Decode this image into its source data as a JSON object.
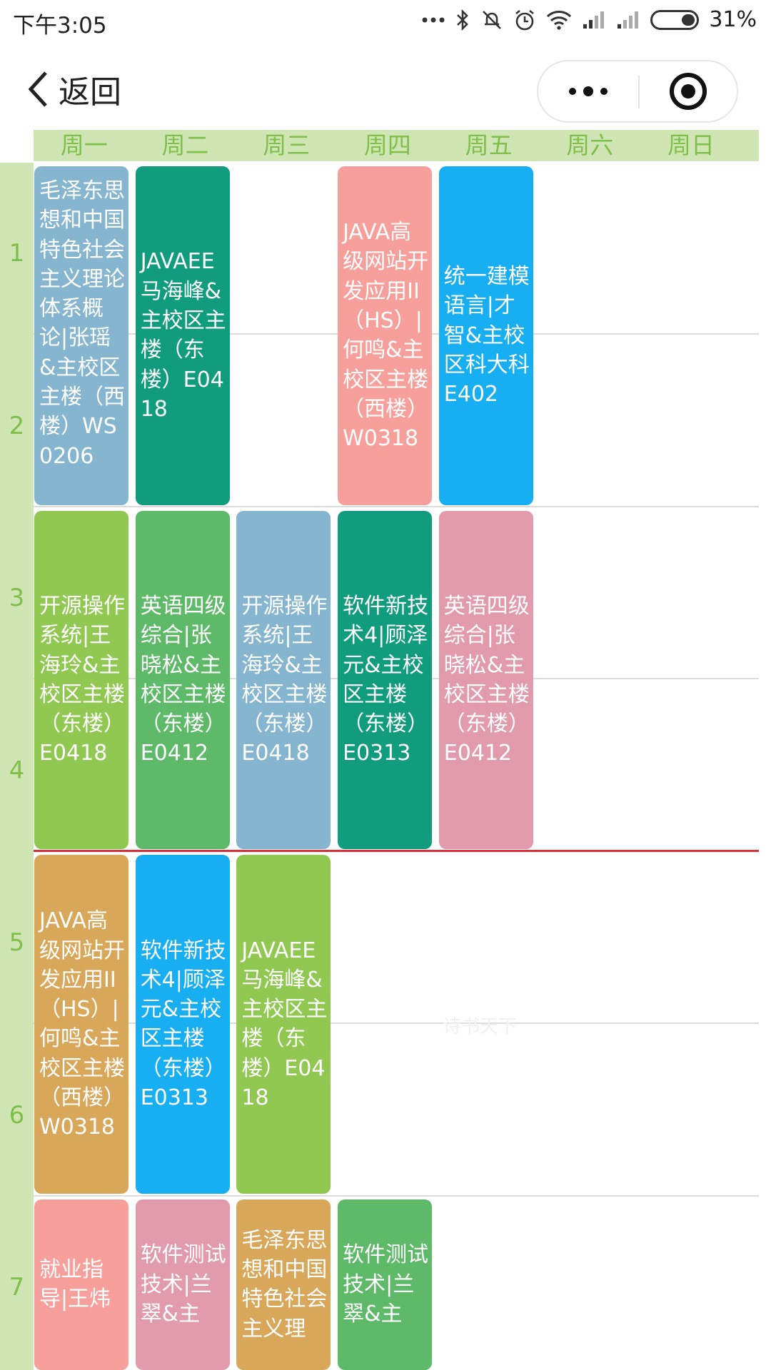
{
  "status_bar": {
    "time": "下午3:05",
    "battery": "31%",
    "icons": [
      "dots-icon",
      "bluetooth-icon",
      "mute-icon",
      "alarm-icon",
      "wifi-icon",
      "signal-icon",
      "signal-icon",
      "battery-icon"
    ]
  },
  "nav": {
    "back_label": "返回",
    "back_icon": "chevron-left-icon",
    "more_icon": "more-dots-icon",
    "close_icon": "target-close-icon"
  },
  "week_days": [
    "周一",
    "周二",
    "周三",
    "周四",
    "周五",
    "周六",
    "周日"
  ],
  "periods": [
    "1",
    "2",
    "3",
    "4",
    "5",
    "6",
    "7"
  ],
  "courses": [
    {
      "text": "毛泽东思想和中国特色社会主义理论体系概论|张瑶&主校区主楼（西楼）WS0206",
      "day": 1,
      "start": 1,
      "span": 2,
      "color": "#86b5cf"
    },
    {
      "text": "JAVAEE马海峰&主校区主楼（东楼）E0418",
      "day": 2,
      "start": 1,
      "span": 2,
      "color": "#119c7e"
    },
    {
      "text": "JAVA高级网站开发应用II（HS）|何鸣&主校区主楼（西楼）W0318",
      "day": 4,
      "start": 1,
      "span": 2,
      "color": "#f79f9a"
    },
    {
      "text": "统一建模语言|才智&主校区科大科E402",
      "day": 5,
      "start": 1,
      "span": 2,
      "color": "#17aef2"
    },
    {
      "text": "开源操作系统|王海玲&主校区主楼（东楼）E0418",
      "day": 1,
      "start": 3,
      "span": 2,
      "color": "#90c851"
    },
    {
      "text": "英语四级综合|张晓松&主校区主楼（东楼）E0412",
      "day": 2,
      "start": 3,
      "span": 2,
      "color": "#5eba69"
    },
    {
      "text": "开源操作系统|王海玲&主校区主楼（东楼）E0418",
      "day": 3,
      "start": 3,
      "span": 2,
      "color": "#86b5cf"
    },
    {
      "text": "软件新技术4|顾泽元&主校区主楼（东楼）E0313",
      "day": 4,
      "start": 3,
      "span": 2,
      "color": "#119c7e"
    },
    {
      "text": "英语四级综合|张晓松&主校区主楼（东楼）E0412",
      "day": 5,
      "start": 3,
      "span": 2,
      "color": "#e29bad"
    },
    {
      "text": "JAVA高级网站开发应用II（HS）|何鸣&主校区主楼（西楼）W0318",
      "day": 1,
      "start": 5,
      "span": 2,
      "color": "#d9a75a"
    },
    {
      "text": "软件新技术4|顾泽元&主校区主楼（东楼）E0313",
      "day": 2,
      "start": 5,
      "span": 2,
      "color": "#17aef2"
    },
    {
      "text": "JAVAEE马海峰&主校区主楼（东楼）E0418",
      "day": 3,
      "start": 5,
      "span": 2,
      "color": "#90c851"
    },
    {
      "text": "就业指导|王炜",
      "day": 1,
      "start": 7,
      "span": 2,
      "color": "#f79f9a"
    },
    {
      "text": "软件测试技术|兰翠&主",
      "day": 2,
      "start": 7,
      "span": 2,
      "color": "#e29bad"
    },
    {
      "text": "毛泽东思想和中国特色社会主义理",
      "day": 3,
      "start": 7,
      "span": 2,
      "color": "#d9a75a"
    },
    {
      "text": "软件测试技术|兰翠&主",
      "day": 4,
      "start": 7,
      "span": 2,
      "color": "#5eba69"
    }
  ],
  "watermark": "诗书天下"
}
